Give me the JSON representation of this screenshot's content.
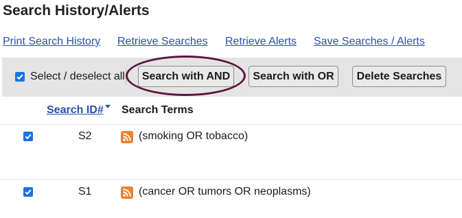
{
  "page": {
    "title": "Search History/Alerts"
  },
  "links": {
    "print_history": "Print Search History",
    "retrieve_searches": "Retrieve Searches",
    "retrieve_alerts": "Retrieve Alerts",
    "save_searches": "Save Searches / Alerts"
  },
  "toolbar": {
    "select_all_label": "Select / deselect all",
    "select_all_checked": true,
    "search_and_label": "Search with AND",
    "search_or_label": "Search with OR",
    "delete_label": "Delete Searches"
  },
  "table": {
    "columns": {
      "search_id": "Search ID#",
      "search_terms": "Search Terms"
    },
    "sort": "descending",
    "rows": [
      {
        "checked": true,
        "id": "S2",
        "icon": "rss-icon",
        "terms": "(smoking OR tobacco)"
      },
      {
        "checked": true,
        "id": "S1",
        "icon": "rss-icon",
        "terms": "(cancer OR tumors OR neoplasms)"
      }
    ]
  },
  "annotation": {
    "highlight_color": "#5b1440"
  },
  "colors": {
    "link": "#2a4fa8",
    "checkbox": "#1a73e8",
    "rss": "#ee802f",
    "toolbar_bg": "#e4e4e4"
  }
}
